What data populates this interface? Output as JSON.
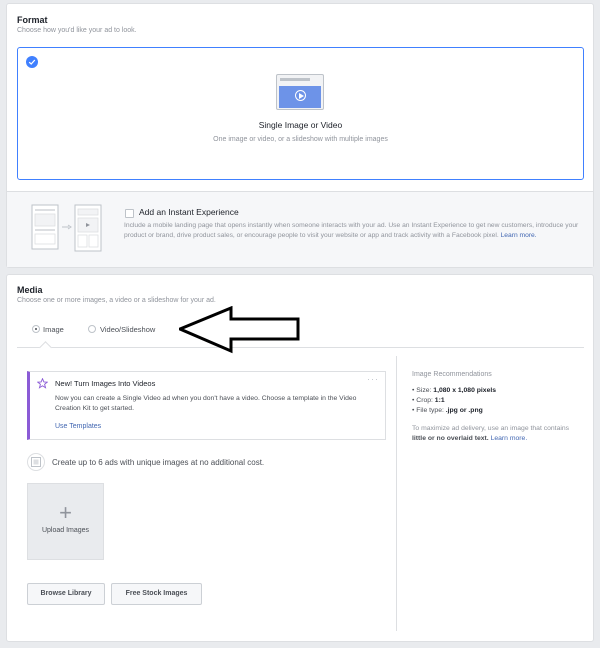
{
  "format": {
    "title": "Format",
    "subtitle": "Choose how you'd like your ad to look.",
    "option": {
      "title": "Single Image or Video",
      "description": "One image or video, or a slideshow with multiple images",
      "selected": true
    },
    "instant_experience": {
      "title": "Add an Instant Experience",
      "description": "Include a mobile landing page that opens instantly when someone interacts with your ad. Use an Instant Experience to get new customers, introduce your product or brand, drive product sales, or encourage people to visit your website or app and track activity with a Facebook pixel.",
      "link": "Learn more.",
      "checked": false
    }
  },
  "media": {
    "title": "Media",
    "subtitle": "Choose one or more images, a video or a slideshow for your ad.",
    "radios": [
      {
        "label": "Image",
        "selected": true
      },
      {
        "label": "Video/Slideshow",
        "selected": false
      }
    ],
    "promo": {
      "title": "New! Turn Images Into Videos",
      "body": "Now you can create a Single Video ad when you don't have a video. Choose a template in the Video Creation Kit to get started.",
      "link": "Use Templates",
      "more": "···"
    },
    "create_note": "Create up to 6 ads with unique images at no additional cost.",
    "upload": {
      "plus": "+",
      "label": "Upload Images"
    },
    "buttons": {
      "browse": "Browse Library",
      "stock": "Free Stock Images"
    },
    "recommendations": {
      "title": "Image Recommendations",
      "items": [
        {
          "label": "Size:",
          "value": "1,080 x 1,080 pixels"
        },
        {
          "label": "Crop:",
          "value": "1:1"
        },
        {
          "label": "File type:",
          "value": ".jpg or .png"
        }
      ],
      "note_pre": "To maximize ad delivery, use an image that contains",
      "note_bold": "little or no overlaid text.",
      "note_link": "Learn more."
    }
  },
  "colors": {
    "accent": "#4080ff",
    "link": "#4267b2",
    "promo_border": "#8b5bd6"
  }
}
